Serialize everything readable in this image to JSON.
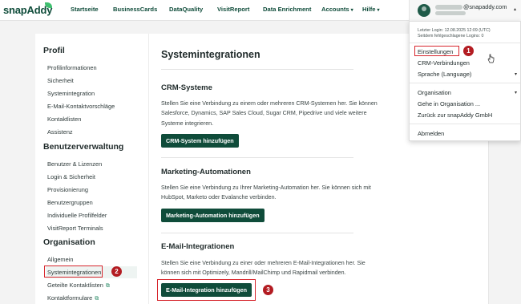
{
  "navbar": {
    "logo": "snapAddy",
    "items": [
      {
        "label": "Startseite"
      },
      {
        "label": "BusinessCards"
      },
      {
        "label": "DataQuality"
      },
      {
        "label": "VisitReport"
      },
      {
        "label": "Data Enrichment"
      },
      {
        "label": "Accounts",
        "caret": "▾"
      },
      {
        "label": "Hilfe",
        "caret": "▾"
      }
    ]
  },
  "user": {
    "email_suffix": "@snapaddy.com",
    "caret": "▴"
  },
  "dropdown": {
    "last_login": "Letzter Login: 12.08.2025 12:09 (UTC)",
    "failed_logins": "Seitdem fehlgeschlagene Logins: 0",
    "items_top": [
      "Einstellungen",
      "CRM-Verbindungen",
      "Sprache (Language)"
    ],
    "organisation_label": "Organisation",
    "items_org": [
      "Gehe in Organisation ...",
      "Zurück zur snapAddy GmbH"
    ],
    "logout": "Abmelden"
  },
  "sidebar": {
    "profil_heading": "Profil",
    "profil_items": [
      "Profilinformationen",
      "Sicherheit",
      "Systemintegration",
      "E-Mail-Kontaktvorschläge",
      "Kontaktlisten",
      "Assistenz"
    ],
    "user_heading": "Benutzerverwaltung",
    "user_items": [
      "Benutzer & Lizenzen",
      "Login & Sicherheit",
      "Provisionierung",
      "Benutzergruppen",
      "Individuelle Profilfelder",
      "VisitReport Terminals"
    ],
    "org_heading": "Organisation",
    "org_items": [
      "Allgemein",
      "Systemintegrationen",
      "Geteilte Kontaktlisten",
      "Kontaktformulare"
    ]
  },
  "main": {
    "title": "Systemintegrationen",
    "sections": [
      {
        "heading": "CRM-Systeme",
        "text": "Stellen Sie eine Verbindung zu einem oder mehreren CRM-Systemen her. Sie können Salesforce, Dynamics, SAP Sales Cloud, Sugar CRM, Pipedrive und viele weitere Systeme integrieren.",
        "button": "CRM-System hinzufügen"
      },
      {
        "heading": "Marketing-Automationen",
        "text": "Stellen Sie eine Verbindung zu Ihrer Marketing-Automation her. Sie können sich mit HubSpot, Marketo oder Evalanche verbinden.",
        "button": "Marketing-Automation hinzufügen"
      },
      {
        "heading": "E-Mail-Integrationen",
        "text": "Stellen Sie eine Verbindung zu einer oder mehreren E-Mail-Integrationen her. Sie können sich mit Optimizely, Mandrill/MailChimp und Rapidmail verbinden.",
        "button": "E-Mail-Integration hinzufügen"
      }
    ]
  },
  "annotations": [
    "1",
    "2",
    "3"
  ],
  "colors": {
    "brand": "#0f4c3a",
    "highlight": "#d7262d",
    "marker": "#b31c22"
  }
}
